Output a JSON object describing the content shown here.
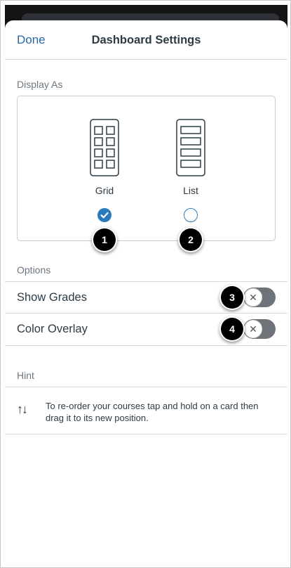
{
  "nav": {
    "done_label": "Done",
    "title": "Dashboard Settings"
  },
  "display_as": {
    "heading": "Display As",
    "options": [
      {
        "label": "Grid",
        "selected": true,
        "marker": "1"
      },
      {
        "label": "List",
        "selected": false,
        "marker": "2"
      }
    ]
  },
  "options": {
    "heading": "Options",
    "rows": [
      {
        "label": "Show Grades",
        "enabled": false,
        "marker": "3",
        "knob_glyph": "✕"
      },
      {
        "label": "Color Overlay",
        "enabled": false,
        "marker": "4",
        "knob_glyph": "✕"
      }
    ]
  },
  "hint": {
    "heading": "Hint",
    "icon": "reorder-arrows-icon",
    "icon_glyph": "↑↓",
    "text": "To re-order your courses tap and hold on a card then drag it to its new position."
  },
  "colors": {
    "accent": "#2a6aa6",
    "radio": "#2b7abc",
    "toggle_off": "#6d7378",
    "text": "#2d3b45"
  }
}
